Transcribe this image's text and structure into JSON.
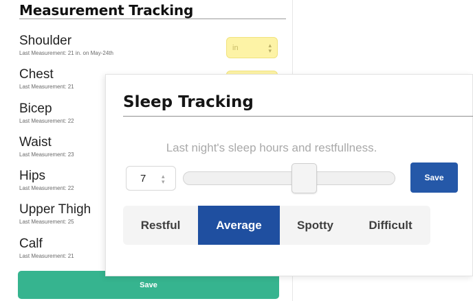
{
  "measurement": {
    "title": "Measurement Tracking",
    "unit_placeholder": "in",
    "save_label": "Save",
    "rows": [
      {
        "label": "Shoulder",
        "last": "Last Measurement: 21 in. on May-24th"
      },
      {
        "label": "Chest",
        "last": "Last Measurement: 21"
      },
      {
        "label": "Bicep",
        "last": "Last Measurement: 22"
      },
      {
        "label": "Waist",
        "last": "Last Measurement: 23"
      },
      {
        "label": "Hips",
        "last": "Last Measurement: 22"
      },
      {
        "label": "Upper Thigh",
        "last": "Last Measurement: 25"
      },
      {
        "label": "Calf",
        "last": "Last Measurement: 21"
      }
    ]
  },
  "sleep": {
    "title": "Sleep Tracking",
    "prompt": "Last night's sleep hours and restfullness.",
    "hours_value": "7",
    "slider_fraction": 0.57,
    "save_label": "Save",
    "options": [
      "Restful",
      "Average",
      "Spotty",
      "Difficult"
    ],
    "selected_option": "Average"
  },
  "colors": {
    "input_highlight": "#fdf3a6",
    "measure_save": "#36b48f",
    "sleep_save": "#2558a8",
    "selected_option": "#1f4fa0"
  },
  "icons": {
    "spinner": "up-down-arrows-icon"
  }
}
